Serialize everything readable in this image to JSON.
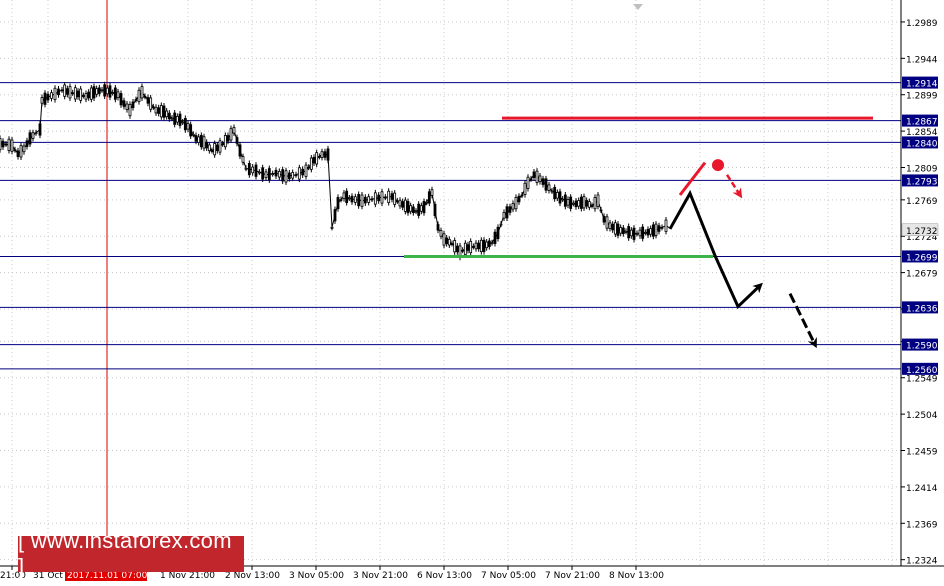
{
  "chart_data": {
    "type": "candlestick",
    "title": "",
    "xlabel": "",
    "ylabel": "",
    "ylim": [
      1.231,
      1.3005
    ],
    "grid": true,
    "grid_style": "dotted",
    "y_ticks": [
      "1.2989",
      "1.2944",
      "1.2899",
      "1.2854",
      "1.2809",
      "1.2769",
      "1.2724",
      "1.2679",
      "1.2634",
      "1.2594",
      "1.2549",
      "1.2504",
      "1.2459",
      "1.2414",
      "1.2369",
      "1.2324"
    ],
    "x_ticks": [
      "21:00",
      "31 Oct",
      "2017.11.01 07:00",
      "1 Nov 21:00",
      "2 Nov 13:00",
      "3 Nov 05:00",
      "3 Nov 21:00",
      "6 Nov 13:00",
      "7 Nov 05:00",
      "7 Nov 21:00",
      "8 Nov 13:00"
    ],
    "cursor_time_label": "2017.11.01 07:00",
    "current_price": "1.2732",
    "price_series": [
      [
        0,
        1.2838
      ],
      [
        6,
        1.2838
      ],
      [
        12,
        1.2836
      ],
      [
        18,
        1.2826
      ],
      [
        24,
        1.2832
      ],
      [
        30,
        1.2845
      ],
      [
        36,
        1.2852
      ],
      [
        40,
        1.2856
      ],
      [
        42,
        1.2892
      ],
      [
        48,
        1.2896
      ],
      [
        55,
        1.29
      ],
      [
        62,
        1.2905
      ],
      [
        70,
        1.2902
      ],
      [
        78,
        1.29
      ],
      [
        86,
        1.2897
      ],
      [
        94,
        1.2902
      ],
      [
        102,
        1.2905
      ],
      [
        110,
        1.2903
      ],
      [
        118,
        1.2899
      ],
      [
        124,
        1.2888
      ],
      [
        130,
        1.288
      ],
      [
        136,
        1.2893
      ],
      [
        142,
        1.2902
      ],
      [
        148,
        1.2892
      ],
      [
        156,
        1.288
      ],
      [
        164,
        1.2878
      ],
      [
        172,
        1.287
      ],
      [
        180,
        1.2868
      ],
      [
        188,
        1.286
      ],
      [
        196,
        1.2845
      ],
      [
        204,
        1.284
      ],
      [
        212,
        1.283
      ],
      [
        220,
        1.2835
      ],
      [
        228,
        1.2845
      ],
      [
        234,
        1.2855
      ],
      [
        240,
        1.283
      ],
      [
        246,
        1.2808
      ],
      [
        256,
        1.2805
      ],
      [
        266,
        1.28
      ],
      [
        276,
        1.2802
      ],
      [
        286,
        1.2798
      ],
      [
        296,
        1.28
      ],
      [
        306,
        1.2805
      ],
      [
        314,
        1.2818
      ],
      [
        322,
        1.2825
      ],
      [
        328,
        1.2825
      ],
      [
        332,
        1.2735
      ],
      [
        338,
        1.2765
      ],
      [
        344,
        1.2774
      ],
      [
        352,
        1.277
      ],
      [
        362,
        1.2768
      ],
      [
        372,
        1.277
      ],
      [
        382,
        1.2772
      ],
      [
        392,
        1.2773
      ],
      [
        400,
        1.2765
      ],
      [
        408,
        1.276
      ],
      [
        416,
        1.2755
      ],
      [
        424,
        1.276
      ],
      [
        432,
        1.2778
      ],
      [
        438,
        1.2735
      ],
      [
        444,
        1.272
      ],
      [
        452,
        1.2715
      ],
      [
        460,
        1.2705
      ],
      [
        468,
        1.271
      ],
      [
        476,
        1.2712
      ],
      [
        484,
        1.2712
      ],
      [
        492,
        1.2716
      ],
      [
        498,
        1.2728
      ],
      [
        504,
        1.275
      ],
      [
        510,
        1.2757
      ],
      [
        516,
        1.2765
      ],
      [
        522,
        1.2775
      ],
      [
        528,
        1.279
      ],
      [
        534,
        1.28
      ],
      [
        540,
        1.2795
      ],
      [
        546,
        1.2788
      ],
      [
        552,
        1.278
      ],
      [
        560,
        1.2772
      ],
      [
        568,
        1.2766
      ],
      [
        576,
        1.2764
      ],
      [
        584,
        1.2766
      ],
      [
        592,
        1.2762
      ],
      [
        598,
        1.2768
      ],
      [
        604,
        1.2745
      ],
      [
        610,
        1.2737
      ],
      [
        618,
        1.2732
      ],
      [
        626,
        1.273
      ],
      [
        634,
        1.2727
      ],
      [
        640,
        1.2728
      ],
      [
        648,
        1.2729
      ],
      [
        656,
        1.2732
      ],
      [
        662,
        1.2735
      ],
      [
        666,
        1.2737
      ],
      [
        670,
        1.2734
      ]
    ],
    "levels": [
      {
        "label": "1.2914",
        "value": 1.2914,
        "color": "#000080"
      },
      {
        "label": "1.2867",
        "value": 1.2867,
        "color": "#000080"
      },
      {
        "label": "1.2840",
        "value": 1.284,
        "color": "#000080"
      },
      {
        "label": "1.2793",
        "value": 1.2793,
        "color": "#000080"
      },
      {
        "label": "1.2699",
        "value": 1.2699,
        "color": "#000080"
      },
      {
        "label": "1.2636",
        "value": 1.2636,
        "color": "#000080"
      },
      {
        "label": "1.2590",
        "value": 1.259,
        "color": "#000080"
      },
      {
        "label": "1.2560",
        "value": 1.256,
        "color": "#000080"
      }
    ],
    "resistance_line": {
      "value": 1.287,
      "color": "#e8172c"
    },
    "support_line": {
      "value": 1.2699,
      "color": "#3cb44b"
    },
    "forecast_path": [
      [
        670,
        1.2733
      ],
      [
        690,
        1.2777
      ],
      [
        715,
        1.27
      ],
      [
        738,
        1.2637
      ],
      [
        760,
        1.2663
      ]
    ],
    "forecast_arrow_down": [
      [
        790,
        1.2653
      ],
      [
        815,
        1.259
      ]
    ],
    "alt_scenario_red": {
      "segment": [
        [
          680,
          1.2775
        ],
        [
          705,
          1.2815
        ]
      ],
      "dot": [
        718,
        1.2812
      ],
      "arrow": [
        [
          727,
          1.28
        ],
        [
          740,
          1.2775
        ]
      ]
    },
    "cursor_x": 107,
    "colors": {
      "grid": "#c8c8c8",
      "candle": "#000000",
      "levels": "#000080",
      "resistance": "#e8172c",
      "support": "#3cb44b",
      "forecast": "#000000",
      "alt": "#e8172c",
      "cursor": "#e10000",
      "label_bg": "#000080",
      "current_bg": "#e6e6e6"
    }
  },
  "watermark": {
    "text": "[ www.instaforex.com ]"
  }
}
